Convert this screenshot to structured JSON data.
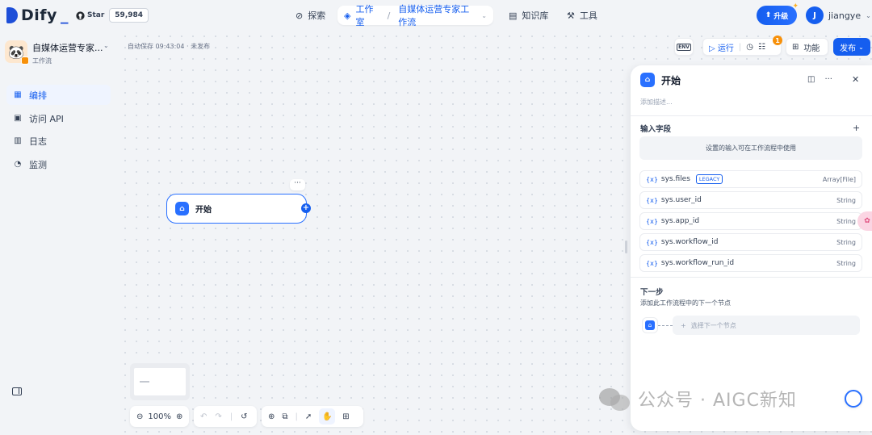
{
  "header": {
    "logo_text": "Dify",
    "github_star_label": "Star",
    "github_star_count": "59,984",
    "nav": {
      "explore": "探索",
      "studio": "工作室",
      "workflow_name": "自媒体运营专家工作流",
      "knowledge": "知识库",
      "tools": "工具"
    },
    "upgrade_label": "升级",
    "user_initial": "J",
    "user_name": "jiangye"
  },
  "sidebar": {
    "app_name": "自媒体运营专家...",
    "app_type": "工作流",
    "items": [
      {
        "label": "编排",
        "icon": "orchestrate-icon",
        "active": true
      },
      {
        "label": "访问 API",
        "icon": "terminal-icon",
        "active": false
      },
      {
        "label": "日志",
        "icon": "log-icon",
        "active": false
      },
      {
        "label": "监测",
        "icon": "monitor-icon",
        "active": false
      }
    ]
  },
  "canvas": {
    "autosave": "自动保存 09:43:04 · 未发布",
    "toolbar": {
      "env_label": "ENV",
      "run_label": "运行",
      "history_badge": "1",
      "features_label": "功能",
      "publish_label": "发布"
    },
    "node": {
      "title": "开始"
    },
    "zoom": "100%"
  },
  "panel": {
    "title": "开始",
    "description_placeholder": "添加描述...",
    "inputs_section": "输入字段",
    "inputs_hint": "设置的输入可在工作流程中使用",
    "variables": [
      {
        "name": "sys.files",
        "legacy": "LEGACY",
        "type": "Array[File]"
      },
      {
        "name": "sys.user_id",
        "legacy": "",
        "type": "String"
      },
      {
        "name": "sys.app_id",
        "legacy": "",
        "type": "String"
      },
      {
        "name": "sys.workflow_id",
        "legacy": "",
        "type": "String"
      },
      {
        "name": "sys.workflow_run_id",
        "legacy": "",
        "type": "String"
      }
    ],
    "next_step_title": "下一步",
    "next_step_desc": "添加此工作流程中的下一个节点",
    "select_next_placeholder": "选择下一个节点"
  },
  "watermark": "公众号 · AIGC新知",
  "colors": {
    "accent": "#155eef",
    "node_border": "#2970ff",
    "badge": "#f79009",
    "background": "#f2f4f7"
  }
}
